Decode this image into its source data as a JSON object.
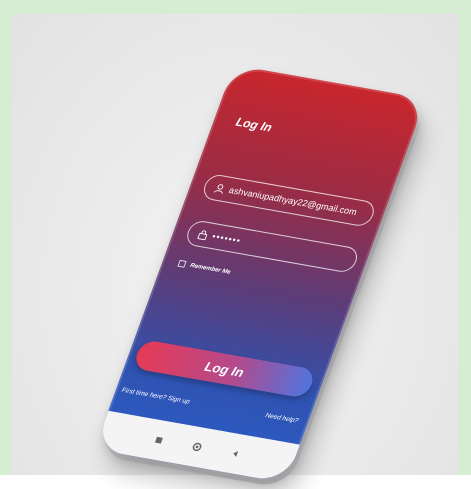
{
  "screen": {
    "title": "Log In"
  },
  "login_form": {
    "email_value": "ashvaniupadhyay22@gmail.com",
    "password_value": "•••••••",
    "remember_label": "Remember Me",
    "submit_label": "Log In"
  },
  "links": {
    "signup": "First time here? Sign up",
    "help": "Need help?"
  },
  "icons": {
    "email": "user-icon",
    "password": "lock-icon",
    "nav": [
      "square-icon",
      "circle-icon",
      "back-icon"
    ]
  },
  "colors": {
    "gradient_top": "#c9262d",
    "gradient_bottom": "#2c5dc8",
    "button_left": "#e63a55",
    "button_right": "#4f74de"
  }
}
